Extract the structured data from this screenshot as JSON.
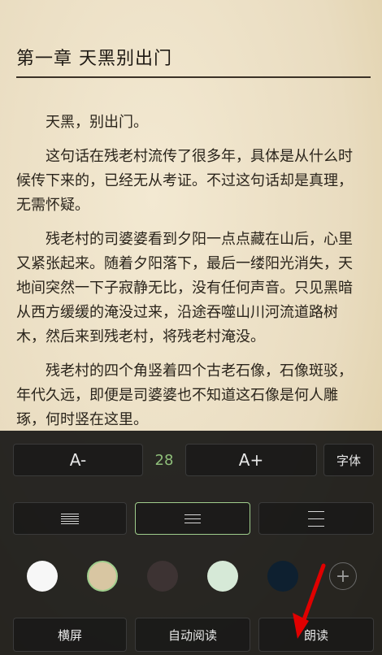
{
  "reader": {
    "chapter_title": "第一章 天黑别出门",
    "paragraphs": [
      "天黑，别出门。",
      "这句话在残老村流传了很多年，具体是从什么时候传下来的，已经无从考证。不过这句话却是真理，无需怀疑。",
      "残老村的司婆婆看到夕阳一点点藏在山后，心里又紧张起来。随着夕阳落下，最后一缕阳光消失，天地间突然一下子寂静无比，没有任何声音。只见黑暗从西方缓缓的淹没过来，沿途吞噬山川河流道路树木，然后来到残老村，将残老村淹没。",
      "残老村的四个角竖着四个古老石像，石像斑驳，年代久远，即便是司婆婆也不知道这石像是何人雕琢，何时竖在这里。"
    ]
  },
  "settings_panel": {
    "font_decrease_label": "A-",
    "font_size_value": "28",
    "font_increase_label": "A+",
    "font_family_label": "字体",
    "spacing_options": [
      "compact",
      "medium",
      "loose"
    ],
    "selected_spacing": "medium",
    "background_colors": [
      "#f7f7f7",
      "#d8c6a2",
      "#3d3333",
      "#d6e9d7",
      "#0e2030"
    ],
    "selected_background": "#d8c6a2",
    "add_background_label": "+",
    "bottom_buttons": {
      "landscape": "横屏",
      "auto_read": "自动阅读",
      "read_aloud": "朗读"
    }
  },
  "annotation": {
    "arrow_color": "#e00000"
  }
}
